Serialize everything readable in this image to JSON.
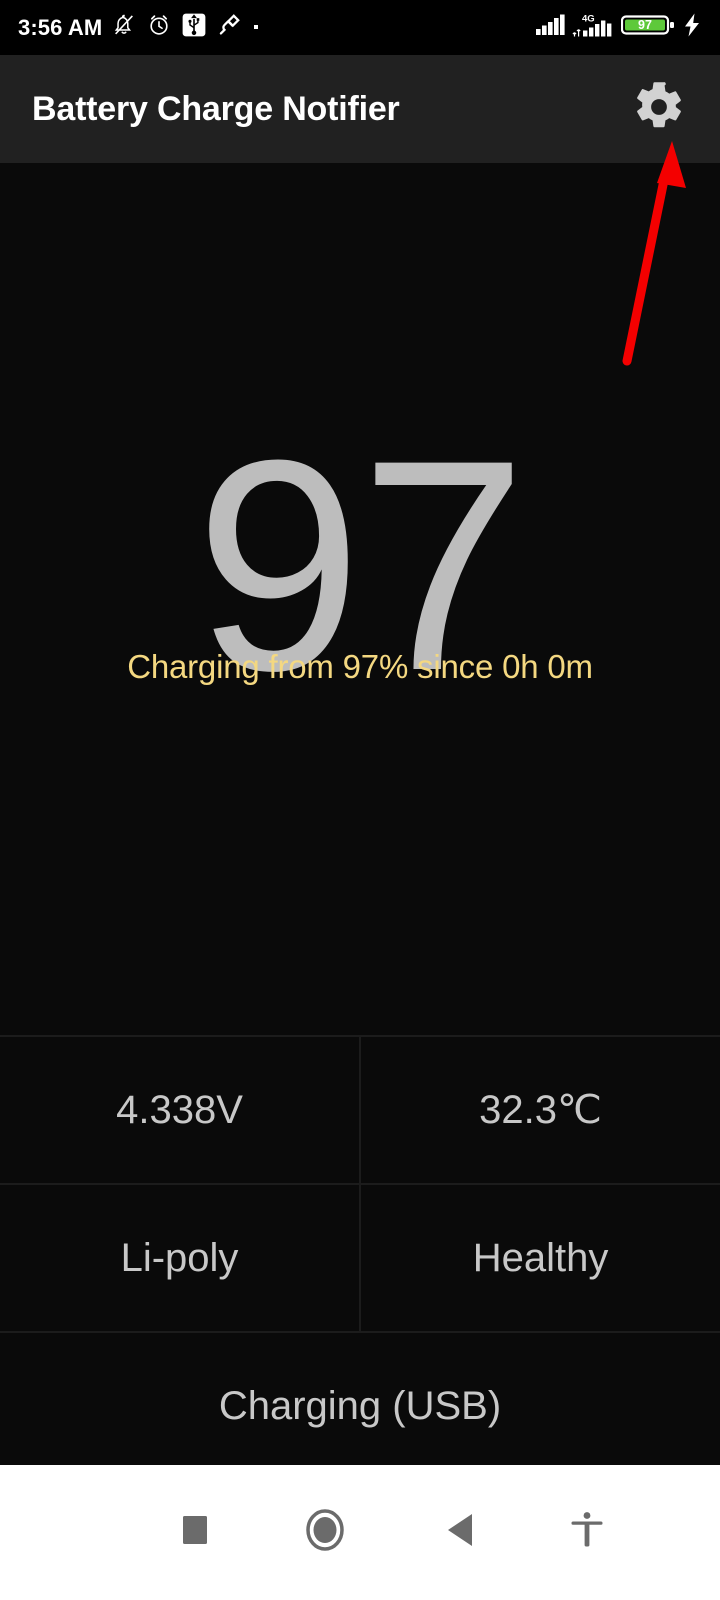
{
  "status_bar": {
    "time": "3:56 AM",
    "icons": [
      {
        "name": "notifications-off-icon"
      },
      {
        "name": "alarm-clock-icon"
      },
      {
        "name": "usb-icon"
      },
      {
        "name": "power-plug-icon"
      },
      {
        "name": "small-dot-icon"
      }
    ],
    "right_icons": [
      {
        "name": "signal-bars-icon"
      },
      {
        "name": "mobile-data-4g-icon",
        "label": "4G"
      },
      {
        "name": "battery-icon",
        "label": "97"
      },
      {
        "name": "charging-bolt-icon"
      }
    ],
    "battery_percent_label": "97",
    "network_label": "4G",
    "colors": {
      "background": "#000000",
      "text": "#ffffff",
      "battery_fill": "#5ec93a"
    }
  },
  "app_bar": {
    "title": "Battery Charge Notifier",
    "settings_icon": "gear-icon",
    "colors": {
      "background": "#212121",
      "title": "#ffffff",
      "icon": "#d2d2d2"
    }
  },
  "main": {
    "battery_level": "97",
    "charging_status": "Charging from 97% since 0h 0m",
    "colors": {
      "background": "#0a0a0a",
      "level_text": "#bdbdbd",
      "status_text": "#f4d881",
      "divider": "#1c1c1c",
      "cell_text": "#c8c8c8"
    },
    "info_grid": [
      [
        {
          "name": "voltage-cell",
          "value": "4.338V"
        },
        {
          "name": "temperature-cell",
          "value": "32.3℃"
        }
      ],
      [
        {
          "name": "technology-cell",
          "value": "Li-poly"
        },
        {
          "name": "health-cell",
          "value": "Healthy"
        }
      ],
      [
        {
          "name": "plug-status-cell",
          "value": "Charging (USB)"
        }
      ]
    ]
  },
  "annotation": {
    "type": "arrow",
    "color": "#f40000",
    "points_to": "settings-gear-button"
  },
  "nav_bar": {
    "background": "#ffffff",
    "icon_color": "#6b6b6b",
    "buttons": [
      {
        "name": "recents-button",
        "icon": "square-icon"
      },
      {
        "name": "home-button",
        "icon": "circle-icon"
      },
      {
        "name": "back-button",
        "icon": "triangle-left-icon"
      },
      {
        "name": "accessibility-button",
        "icon": "accessibility-icon"
      }
    ]
  }
}
